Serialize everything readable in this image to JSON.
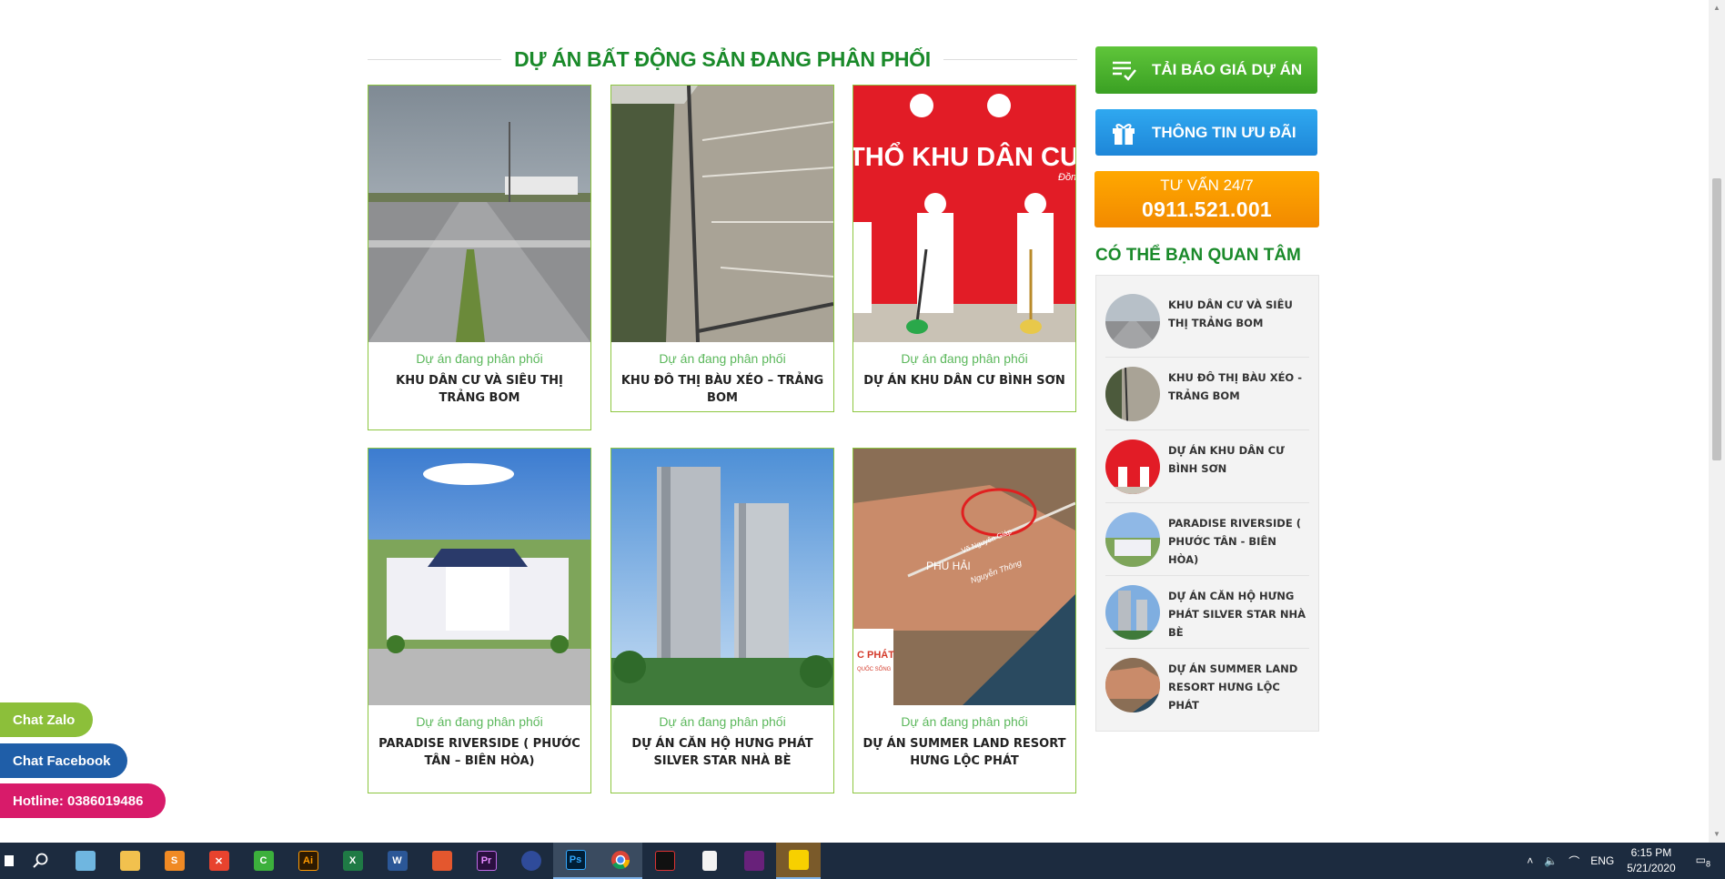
{
  "section_title": "DỰ ÁN BẤT ĐỘNG SẢN ĐANG PHÂN PHỐI",
  "projects": [
    {
      "category": "Dự án đang phân phối",
      "name": "KHU DÂN CƯ VÀ SIÊU THỊ TRẢNG BOM"
    },
    {
      "category": "Dự án đang phân phối",
      "name": "KHU ĐÔ THỊ BÀU XÉO – TRẢNG BOM"
    },
    {
      "category": "Dự án đang phân phối",
      "name": "DỰ ÁN KHU DÂN CƯ BÌNH SƠN"
    },
    {
      "category": "Dự án đang phân phối",
      "name": "PARADISE RIVERSIDE ( PHƯỚC TÂN – BIÊN HÒA)"
    },
    {
      "category": "Dự án đang phân phối",
      "name": "DỰ ÁN CĂN HỘ HƯNG PHÁT SILVER STAR NHÀ BÈ"
    },
    {
      "category": "Dự án đang phân phối",
      "name": "DỰ ÁN SUMMER LAND RESORT HƯNG LỘC PHÁT"
    }
  ],
  "thumb_text": {
    "binh_son_banner": "THỔ KHU DÂN CƯ BÌ",
    "binh_son_sub": "Đồn",
    "map_place": "PHÚ HẢI",
    "map_road1": "Võ Nguyên Giáp",
    "map_road2": "Nguyễn Thông",
    "map_logo": "C PHÁT",
    "map_logo_sub": "QUỐC SỐNG"
  },
  "sidebar": {
    "download_price": "TẢI BÁO GIÁ DỰ ÁN",
    "promotion_info": "THÔNG TIN ƯU ĐÃI",
    "advice_label": "TƯ VẤN 24/7",
    "advice_phone": "0911.521.001",
    "related_title": "CÓ THỂ BẠN QUAN TÂM",
    "related": [
      "KHU DÂN CƯ VÀ SIÊU THỊ TRẢNG BOM",
      "KHU ĐÔ THỊ BÀU XÉO - TRẢNG BOM",
      "DỰ ÁN KHU DÂN CƯ BÌNH SƠN",
      "PARADISE RIVERSIDE ( PHƯỚC TÂN - BIÊN HÒA)",
      "DỰ ÁN CĂN HỘ HƯNG PHÁT SILVER STAR NHÀ BÈ",
      "DỰ ÁN SUMMER LAND RESORT HƯNG LỘC PHÁT"
    ]
  },
  "floating": {
    "zalo": "Chat Zalo",
    "facebook": "Chat Facebook",
    "hotline": "Hotline: 0386019486"
  },
  "taskbar": {
    "apps": [
      "Ai",
      "W",
      "Pr",
      "Ps"
    ],
    "language": "ENG",
    "time": "6:15 PM",
    "date": "5/21/2020",
    "notifications": "8"
  },
  "colors": {
    "title_green": "#1a8a2a",
    "card_border": "#8cc63f",
    "category_green": "#5cb85c",
    "btn_green": "#3aa023",
    "btn_blue": "#1e86d8",
    "btn_orange": "#f28a00",
    "zalo": "#8cbf3a",
    "facebook": "#1f5ea8",
    "hotline": "#d81b6a",
    "taskbar": "#1c2b3f"
  }
}
